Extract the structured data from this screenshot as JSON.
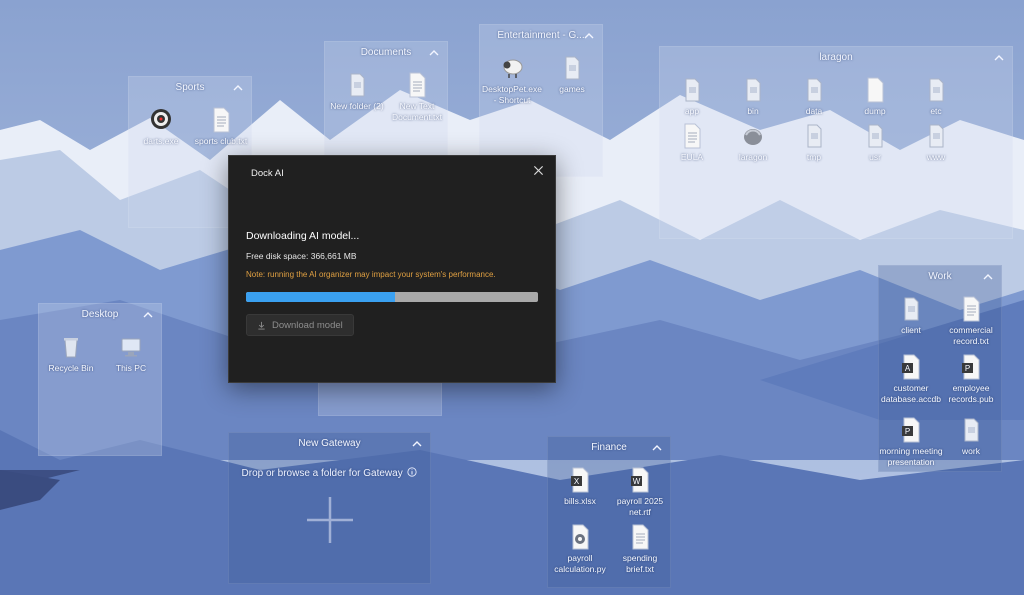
{
  "fences": {
    "sports": {
      "title": "Sports",
      "items": [
        {
          "label": "darts.exe",
          "icon": "dartboard-icon"
        },
        {
          "label": "sports club.txt",
          "icon": "text-file-icon"
        }
      ]
    },
    "documents": {
      "title": "Documents",
      "items": [
        {
          "label": "New folder (2)",
          "icon": "folder-icon"
        },
        {
          "label": "New Text Document.txt",
          "icon": "text-file-icon"
        }
      ]
    },
    "entertainment": {
      "title": "Entertainment - G...",
      "items": [
        {
          "label": "DesktopPet.exe - Shortcut",
          "icon": "sheep-icon"
        },
        {
          "label": "games",
          "icon": "folder-icon"
        }
      ]
    },
    "laragon": {
      "title": "laragon",
      "items": [
        {
          "label": "app",
          "icon": "folder-icon"
        },
        {
          "label": "bin",
          "icon": "folder-icon"
        },
        {
          "label": "data",
          "icon": "folder-icon"
        },
        {
          "label": "dump",
          "icon": "file-icon"
        },
        {
          "label": "etc",
          "icon": "folder-icon"
        },
        {
          "label": "EULA",
          "icon": "text-file-icon"
        },
        {
          "label": "laragon",
          "icon": "laragon-app-icon"
        },
        {
          "label": "tmp",
          "icon": "folder-icon"
        },
        {
          "label": "usr",
          "icon": "folder-icon"
        },
        {
          "label": "www",
          "icon": "folder-icon"
        }
      ]
    },
    "desktop": {
      "title": "Desktop",
      "items": [
        {
          "label": "Recycle Bin",
          "icon": "recycle-bin-icon"
        },
        {
          "label": "This PC",
          "icon": "this-pc-icon"
        }
      ]
    },
    "work": {
      "title": "Work",
      "items": [
        {
          "label": "client",
          "icon": "folder-icon"
        },
        {
          "label": "commercial record.txt",
          "icon": "text-file-icon"
        },
        {
          "label": "customer database.accdb",
          "icon": "access-file-icon"
        },
        {
          "label": "employee records.pub",
          "icon": "publisher-file-icon"
        },
        {
          "label": "morning meeting presentation",
          "icon": "powerpoint-file-icon"
        },
        {
          "label": "work",
          "icon": "folder-icon"
        }
      ]
    },
    "gateway": {
      "title": "New Gateway",
      "drop_text": "Drop or browse a folder for Gateway"
    },
    "finance": {
      "title": "Finance",
      "items": [
        {
          "label": "bills.xlsx",
          "icon": "excel-file-icon"
        },
        {
          "label": "payroll 2025 net.rtf",
          "icon": "word-file-icon"
        },
        {
          "label": "payroll calculation.py",
          "icon": "python-file-icon"
        },
        {
          "label": "spending brief.txt",
          "icon": "text-file-icon"
        }
      ]
    }
  },
  "dialog": {
    "title": "Dock AI",
    "heading": "Downloading AI model...",
    "disk_space": "Free disk space: 366,661 MB",
    "note": "Note: running the AI organizer may impact your system's performance.",
    "progress": 0.51,
    "button_label": "Download model",
    "colors": {
      "accent": "#3aa0f0",
      "note": "#e0a042",
      "background": "#202020"
    }
  }
}
